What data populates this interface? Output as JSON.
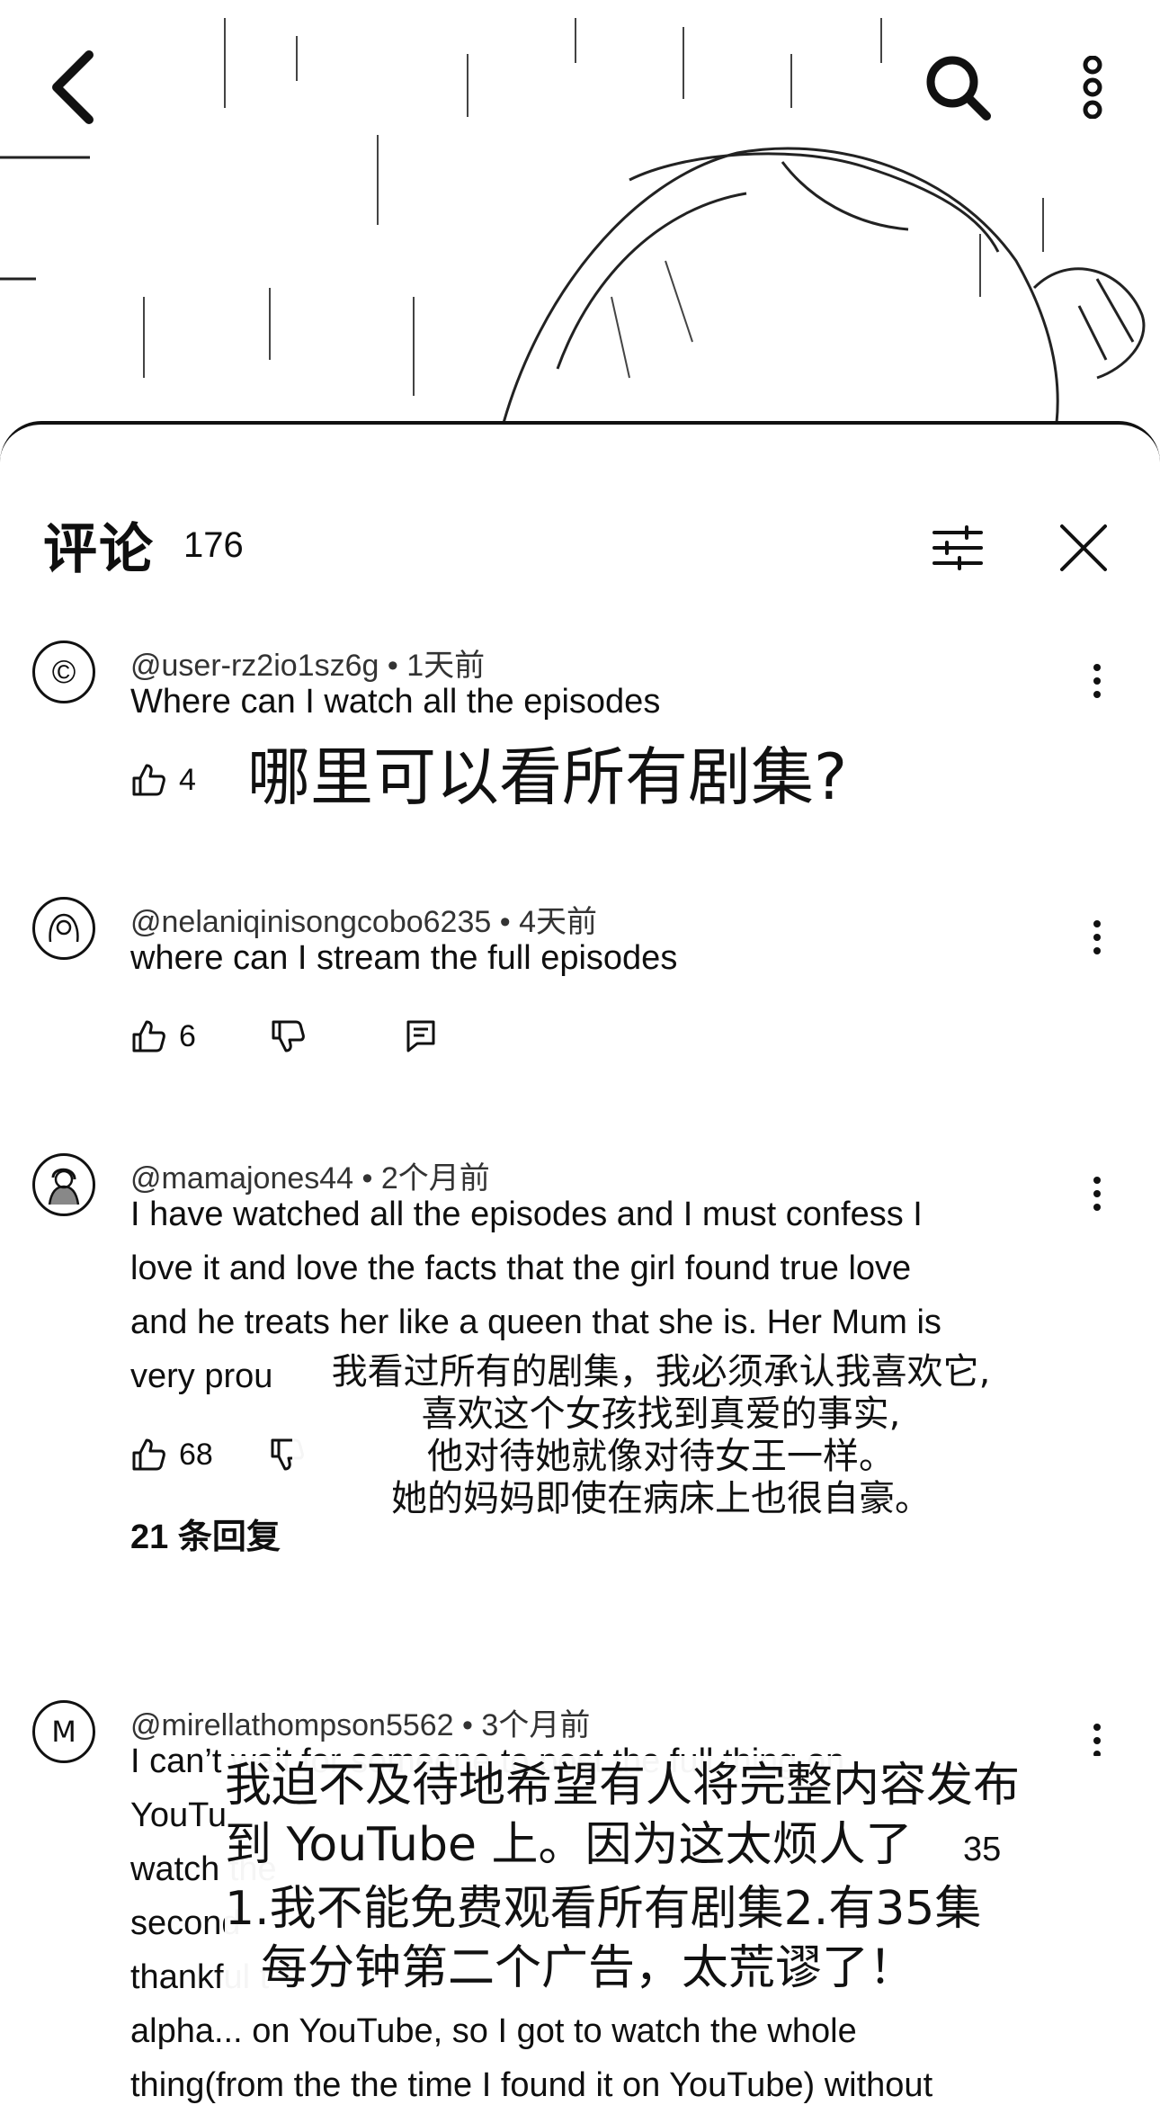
{
  "top_bar": {
    "back_icon": "chevron-left-icon",
    "search_icon": "search-icon",
    "more_icon": "more-vertical-icon"
  },
  "sheet": {
    "title": "评论",
    "count": "176"
  },
  "comments": [
    {
      "author": "@user-rz2io1sz6g",
      "time": "1天前",
      "avatar_letter": "©",
      "text": "Where can I watch all the episodes",
      "likes": "4",
      "overlay": "哪里可以看所有剧集?"
    },
    {
      "author": "@nelaniqinisongcobo6235",
      "time": "4天前",
      "text": "where can I stream the full episodes",
      "likes": "6"
    },
    {
      "author": "@mamajones44",
      "time": "2个月前",
      "lines": [
        "I have watched all the episodes and I must confess I",
        "love it and love the facts that the girl found true love",
        "and he treats her like a queen that she is. Her Mum is",
        "very prou"
      ],
      "likes": "68",
      "replies": "21 条回复",
      "overlay_lines": [
        "我看过所有的剧集，我必须承认我喜欢它,",
        "喜欢这个女孩找到真爱的事实,",
        "他对待她就像对待女王一样。",
        "她的妈妈即使在病床上也很自豪。"
      ]
    },
    {
      "author": "@mirellathompson5562",
      "time": "3个月前",
      "avatar_letter": "M",
      "lines": [
        "I can’t wait for someone to post the full thing on",
        "YouTu",
        "watch the",
        "second",
        "thankful t",
        "alpha... on YouTube, so I got to watch the whole",
        "thing(from the the time I found it on YouTube) without"
      ],
      "trailing_35": "35",
      "overlay_lines": [
        "我迫不及待地希望有人将完整内容发布",
        "到 YouTube 上。因为这太烦人了",
        "1.我不能免费观看所有剧集2.有35集",
        "每分钟第二个广告，太荒谬了！"
      ]
    }
  ]
}
